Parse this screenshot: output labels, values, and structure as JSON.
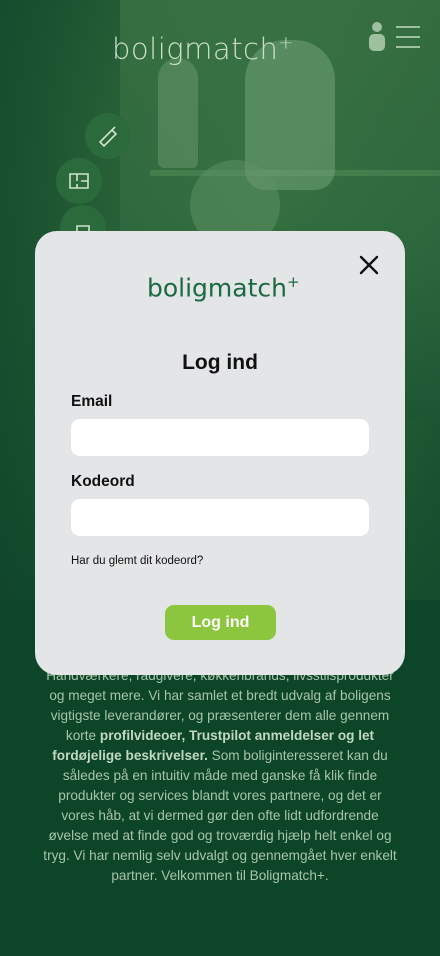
{
  "header": {
    "brand": "boligmatch",
    "brand_plus": "+",
    "user_icon": "user-icon",
    "menu_icon": "hamburger-menu-icon"
  },
  "quick_actions": [
    {
      "icon": "saw-icon"
    },
    {
      "icon": "floorplan-icon"
    },
    {
      "icon": "tool-icon"
    }
  ],
  "modal": {
    "logo": "boligmatch",
    "logo_plus": "+",
    "close_icon": "close-icon",
    "title": "Log ind",
    "email_label": "Email",
    "email_value": "",
    "password_label": "Kodeord",
    "password_value": "",
    "forgot_link": "Har du glemt dit kodeord?",
    "submit_label": "Log ind"
  },
  "body_text": {
    "line_start": "Håndværkere, rådgivere, køkkenbrands, livsstilsprodukter og meget mere. Vi har samlet et bredt udvalg af boligens vigtigste leverandører, og præsenterer dem alle gennem korte ",
    "bold_part": "profilvideoer, Trustpilot anmeldelser og let fordøjelige beskrivelser.",
    "line_end": " Som boliginteresseret kan du således på en intuitiv måde med ganske få klik finde produkter og services blandt vores partnere, og det er vores håb, at vi dermed gør den ofte lidt udfordrende øvelse med at finde god og troværdig hjælp helt enkel og tryg. Vi har nemlig selv udvalgt og gennemgået hver enkelt partner. Velkommen til Boligmatch+."
  },
  "colors": {
    "accent": "#8cc63f",
    "brand_green": "#1a6a42",
    "background": "#0c4527",
    "modal": "#e4e5e7"
  }
}
